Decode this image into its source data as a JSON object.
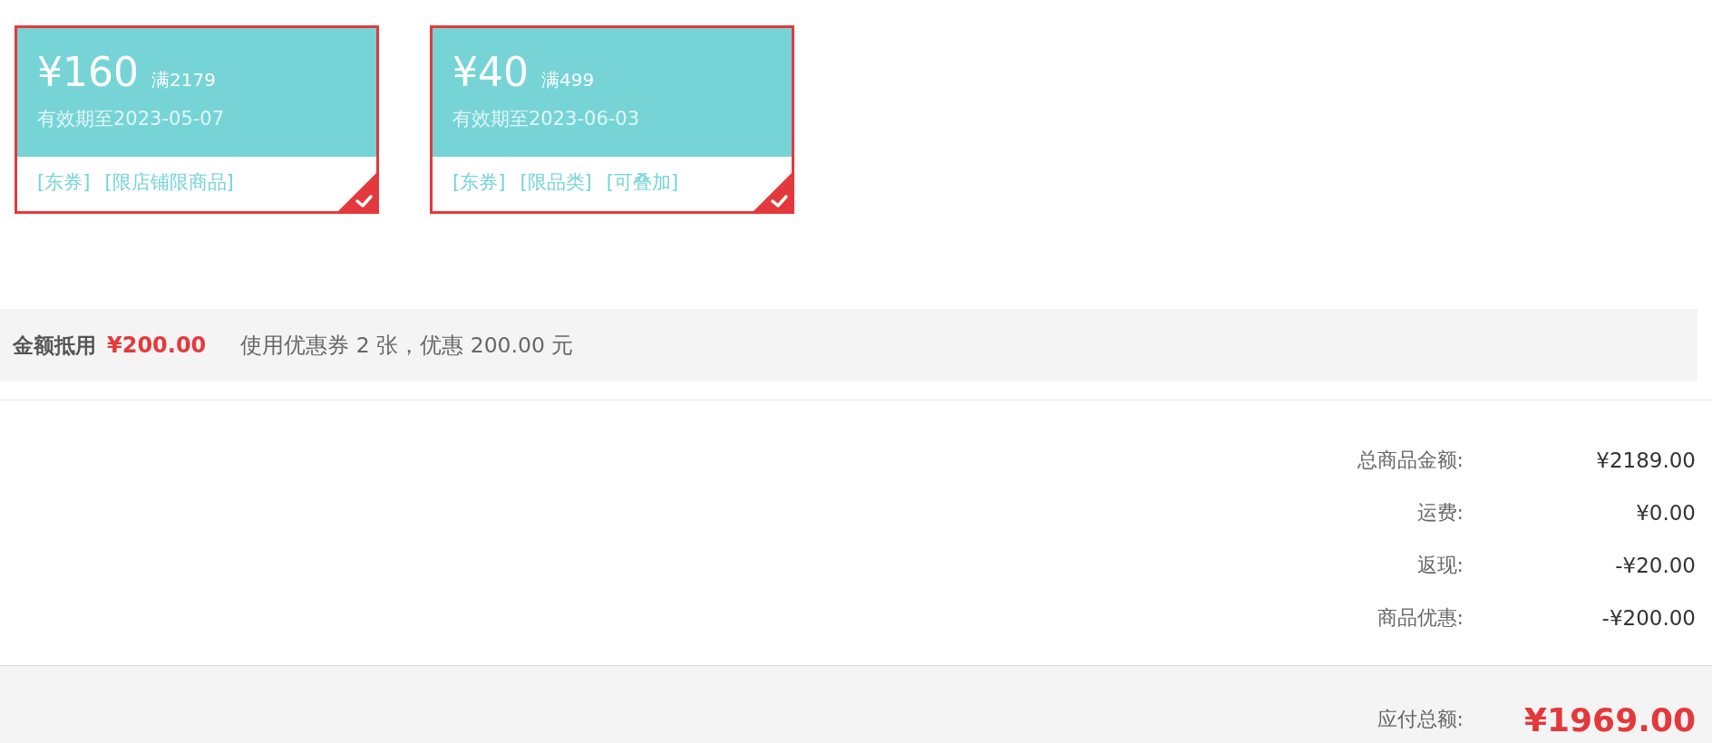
{
  "coupons": [
    {
      "amount": "¥160",
      "condition": "满2179",
      "validity": "有效期至2023-05-07",
      "tags": [
        "[东券]",
        "[限店铺限商品]"
      ],
      "selected": true
    },
    {
      "amount": "¥40",
      "condition": "满499",
      "validity": "有效期至2023-06-03",
      "tags": [
        "[东券]",
        "[限品类]",
        "[可叠加]"
      ],
      "selected": true
    }
  ],
  "deduction": {
    "label": "金额抵用",
    "amount": "¥200.00",
    "summary": "使用优惠券 2 张，优惠 200.00 元"
  },
  "totals": [
    {
      "label": "总商品金额:",
      "value": "¥2189.00"
    },
    {
      "label": "运费:",
      "value": "¥0.00"
    },
    {
      "label": "返现:",
      "value": "-¥20.00"
    },
    {
      "label": "商品优惠:",
      "value": "-¥200.00"
    }
  ],
  "payable": {
    "label": "应付总额:",
    "value": "¥1969.00"
  }
}
